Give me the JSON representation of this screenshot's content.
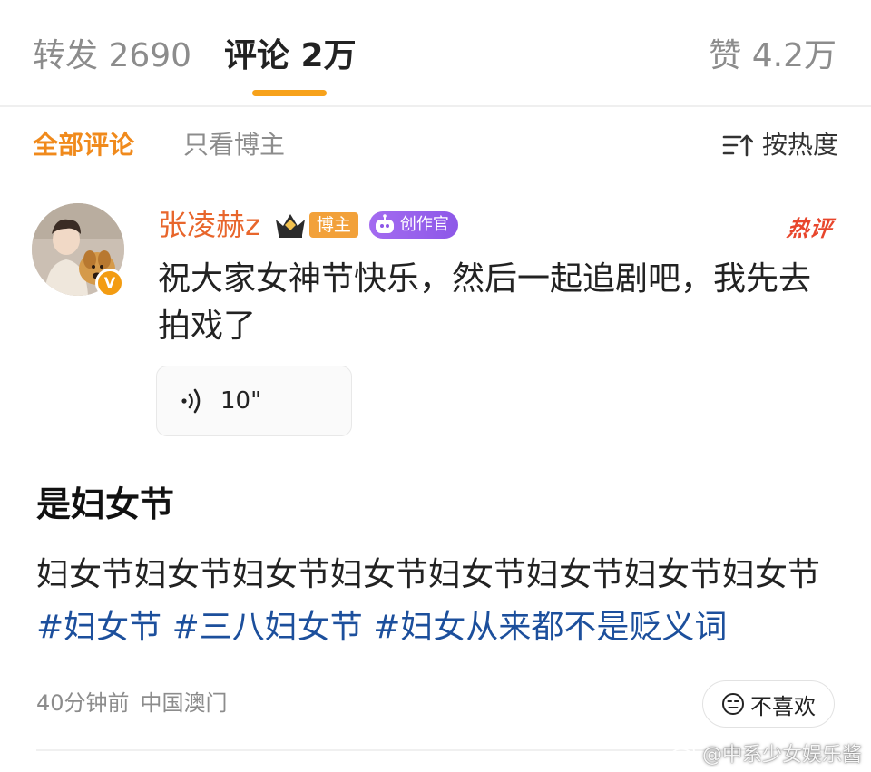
{
  "tabs": {
    "repost_label": "转发 2690",
    "comments_label": "评论 2万",
    "likes_label": "赞 4.2万",
    "accent_color": "#f7a21b"
  },
  "filters": {
    "all_label": "全部评论",
    "owner_only_label": "只看博主",
    "sort_label": "按热度",
    "sort_icon": "sort-icon"
  },
  "comment": {
    "username": "张凌赫z",
    "badge_owner": "博主",
    "badge_creator": "创作官",
    "hot_tag": "热评",
    "text": "祝大家女神节快乐，然后一起追剧吧，我先去拍戏了",
    "voice_duration": "10\"",
    "verified_mark": "V"
  },
  "post": {
    "title": "是妇女节",
    "body_plain": "妇女节妇女节妇女节妇女节妇女节妇女节妇女节妇女节",
    "tags": [
      "#妇女节",
      "#三八妇女节",
      "#妇女从来都不是贬义词"
    ]
  },
  "meta": {
    "time": "40分钟前",
    "location": "中国澳门",
    "dislike_label": "不喜欢"
  },
  "watermark": {
    "text": "@中系少女娱乐酱"
  }
}
